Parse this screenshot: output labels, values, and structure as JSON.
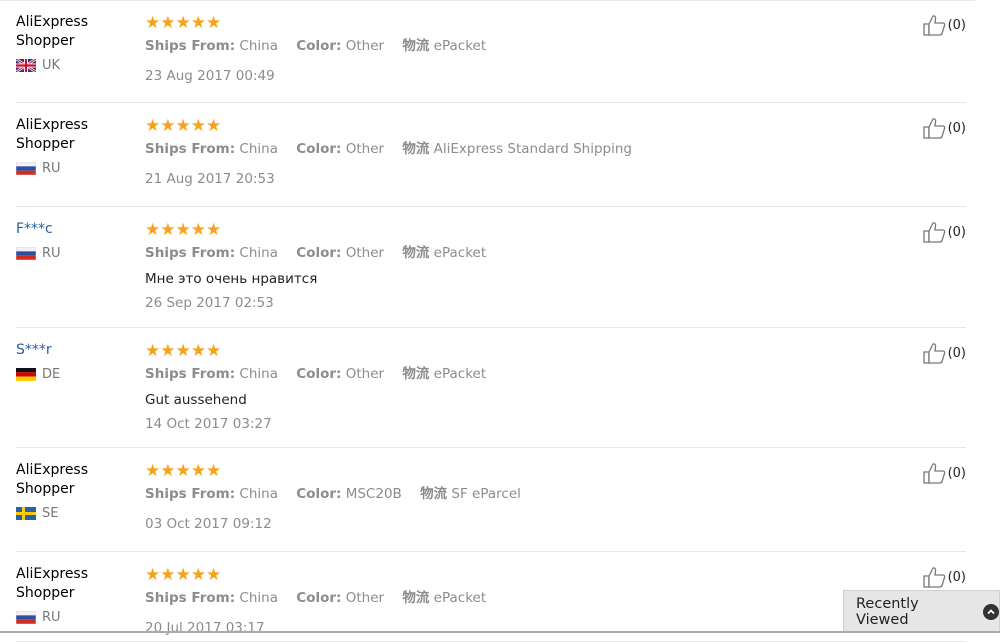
{
  "reviews": [
    {
      "name": "AliExpress Shopper",
      "masked": false,
      "country": "UK",
      "flag": "uk",
      "stars": "★★★★★",
      "ships_from_key": "Ships From:",
      "ships_from": "China",
      "color_key": "Color:",
      "color": "Other",
      "logistics_key": "物流",
      "logistics": "ePacket",
      "comment": "",
      "date": "23 Aug 2017 00:49",
      "helpful": "(0)"
    },
    {
      "name": "AliExpress Shopper",
      "masked": false,
      "country": "RU",
      "flag": "ru",
      "stars": "★★★★★",
      "ships_from_key": "Ships From:",
      "ships_from": "China",
      "color_key": "Color:",
      "color": "Other",
      "logistics_key": "物流",
      "logistics": "AliExpress Standard Shipping",
      "comment": "",
      "date": "21 Aug 2017 20:53",
      "helpful": "(0)"
    },
    {
      "name": "F***c",
      "masked": true,
      "country": "RU",
      "flag": "ru",
      "stars": "★★★★★",
      "ships_from_key": "Ships From:",
      "ships_from": "China",
      "color_key": "Color:",
      "color": "Other",
      "logistics_key": "物流",
      "logistics": "ePacket",
      "comment": "Мне это очень нравится",
      "date": "26 Sep 2017 02:53",
      "helpful": "(0)"
    },
    {
      "name": "S***r",
      "masked": true,
      "country": "DE",
      "flag": "de",
      "stars": "★★★★★",
      "ships_from_key": "Ships From:",
      "ships_from": "China",
      "color_key": "Color:",
      "color": "Other",
      "logistics_key": "物流",
      "logistics": "ePacket",
      "comment": "Gut aussehend",
      "date": "14 Oct 2017 03:27",
      "helpful": "(0)"
    },
    {
      "name": "AliExpress Shopper",
      "masked": false,
      "country": "SE",
      "flag": "se",
      "stars": "★★★★★",
      "ships_from_key": "Ships From:",
      "ships_from": "China",
      "color_key": "Color:",
      "color": "MSC20B",
      "logistics_key": "物流",
      "logistics": "SF eParcel",
      "comment": "",
      "date": "03 Oct 2017 09:12",
      "helpful": "(0)"
    },
    {
      "name": "AliExpress Shopper",
      "masked": false,
      "country": "RU",
      "flag": "ru",
      "stars": "★★★★★",
      "ships_from_key": "Ships From:",
      "ships_from": "China",
      "color_key": "Color:",
      "color": "Other",
      "logistics_key": "物流",
      "logistics": "ePacket",
      "comment": "",
      "date": "20 Jul 2017 03:17",
      "helpful": "(0)"
    }
  ],
  "recently_viewed": {
    "label": "Recently Viewed",
    "icon": "chevron-up-icon"
  },
  "colors": {
    "star": "#f5a31a",
    "masked_name": "#2a5d9f",
    "muted": "#8c8c8c"
  }
}
